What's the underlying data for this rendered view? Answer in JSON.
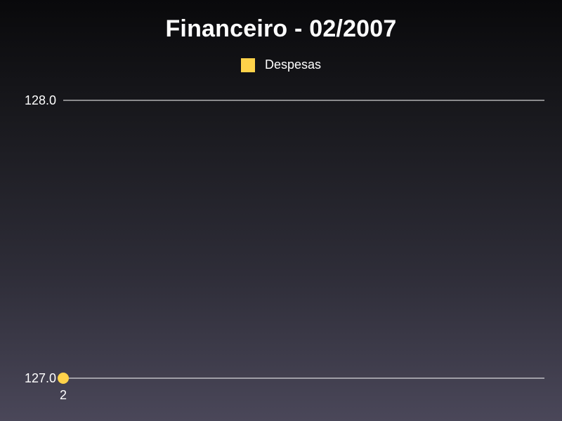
{
  "chart_data": {
    "type": "line",
    "title": "Financeiro - 02/2007",
    "xlabel": "",
    "ylabel": "",
    "categories": [
      "2"
    ],
    "series": [
      {
        "name": "Despesas",
        "values": [
          127.0
        ],
        "color": "#ffd24a"
      }
    ],
    "yticks": [
      "127.0",
      "128.0"
    ],
    "ylim": [
      127.0,
      128.0
    ],
    "grid": true,
    "legend_position": "top-center"
  },
  "colors": {
    "grid": "#ffffff",
    "text": "#ffffff"
  }
}
